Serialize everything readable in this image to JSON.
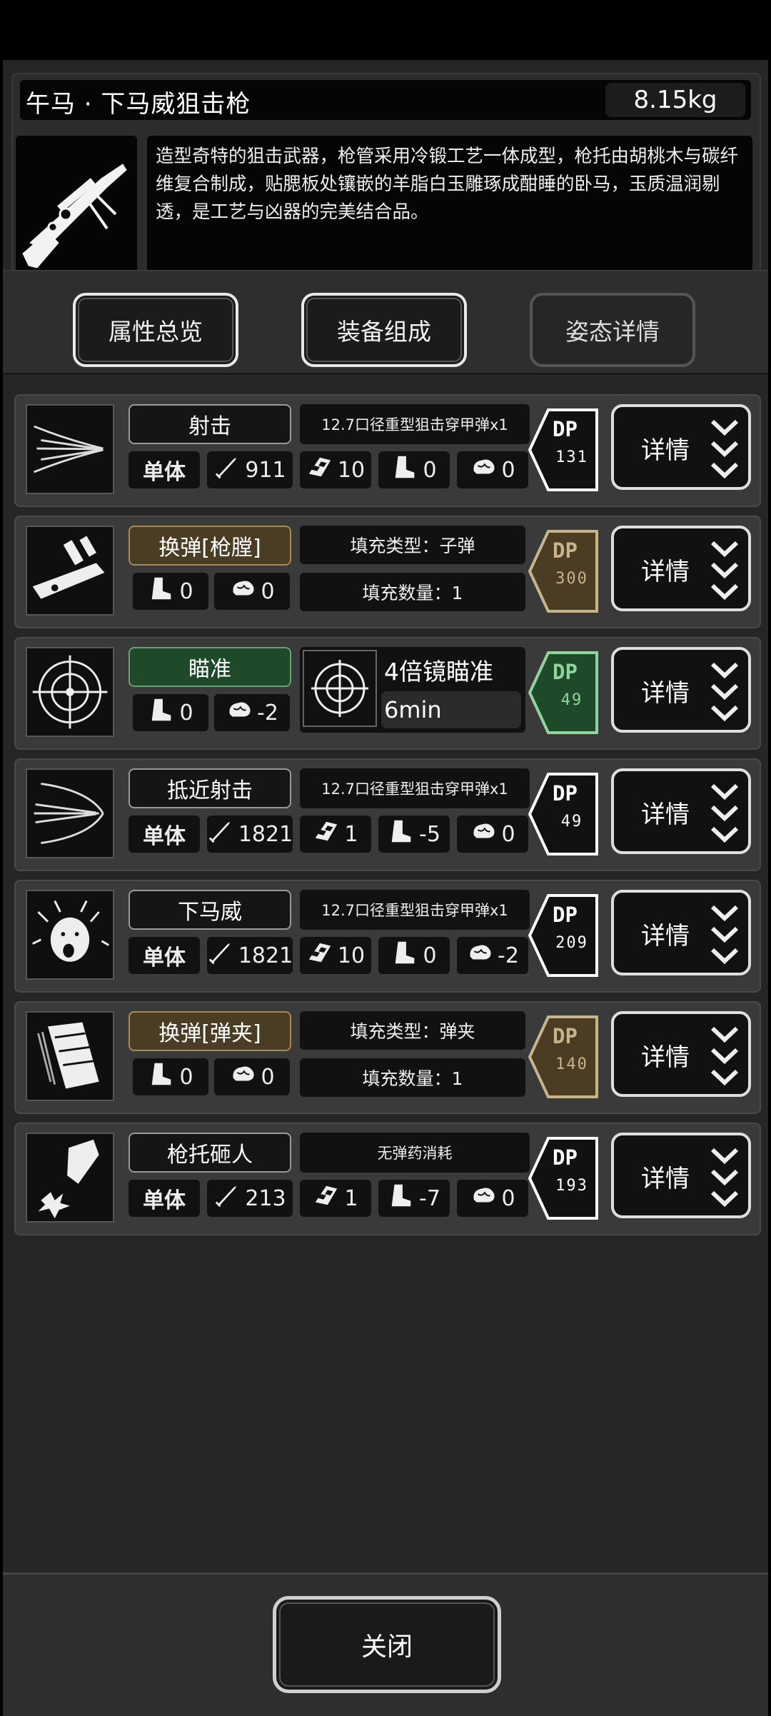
{
  "weapon": {
    "title": "午马 · 下马威狙击枪",
    "weight": "8.15kg",
    "description": "造型奇特的狙击武器，枪管采用冷锻工艺一体成型，枪托由胡桃木与碳纤维复合制成，贴腮板处镶嵌的羊脂白玉雕琢成酣睡的卧马，玉质温润剔透，是工艺与凶器的完美结合品。"
  },
  "tabs": [
    {
      "label": "属性总览"
    },
    {
      "label": "装备组成"
    },
    {
      "label": "姿态详情"
    }
  ],
  "dp_label": "DP",
  "detail_label": "详情",
  "actions": [
    {
      "name": "射击",
      "target": "单体",
      "damage": "911",
      "accuracy": "10",
      "move": "0",
      "mind": "0",
      "ammo": "12.7口径重型狙击穿甲弹x1",
      "dp": "131"
    },
    {
      "name": "换弹[枪膛]",
      "move": "0",
      "mind": "0",
      "fill_type": "填充类型：子弹",
      "fill_count": "填充数量：1",
      "dp": "300"
    },
    {
      "name": "瞄准",
      "move": "0",
      "mind": "-2",
      "scope_title": "4倍镜瞄准",
      "scope_time": "6min",
      "dp": "49"
    },
    {
      "name": "抵近射击",
      "target": "单体",
      "damage": "1821",
      "accuracy": "1",
      "move": "-5",
      "mind": "0",
      "ammo": "12.7口径重型狙击穿甲弹x1",
      "dp": "49"
    },
    {
      "name": "下马威",
      "target": "单体",
      "damage": "1821",
      "accuracy": "10",
      "move": "0",
      "mind": "-2",
      "ammo": "12.7口径重型狙击穿甲弹x1",
      "dp": "209"
    },
    {
      "name": "换弹[弹夹]",
      "move": "0",
      "mind": "0",
      "fill_type": "填充类型：弹夹",
      "fill_count": "填充数量：1",
      "dp": "140"
    },
    {
      "name": "枪托砸人",
      "target": "单体",
      "damage": "213",
      "accuracy": "1",
      "move": "-7",
      "mind": "0",
      "ammo": "无弹药消耗",
      "dp": "193"
    }
  ],
  "colors": {
    "dp_white": "#ffffff",
    "dp_brown": "#c8b48a",
    "dp_green": "#8fd49c",
    "brown_fill": "#4b3d24",
    "green_fill": "#1e4a2a"
  },
  "footer": {
    "close_label": "关闭"
  }
}
